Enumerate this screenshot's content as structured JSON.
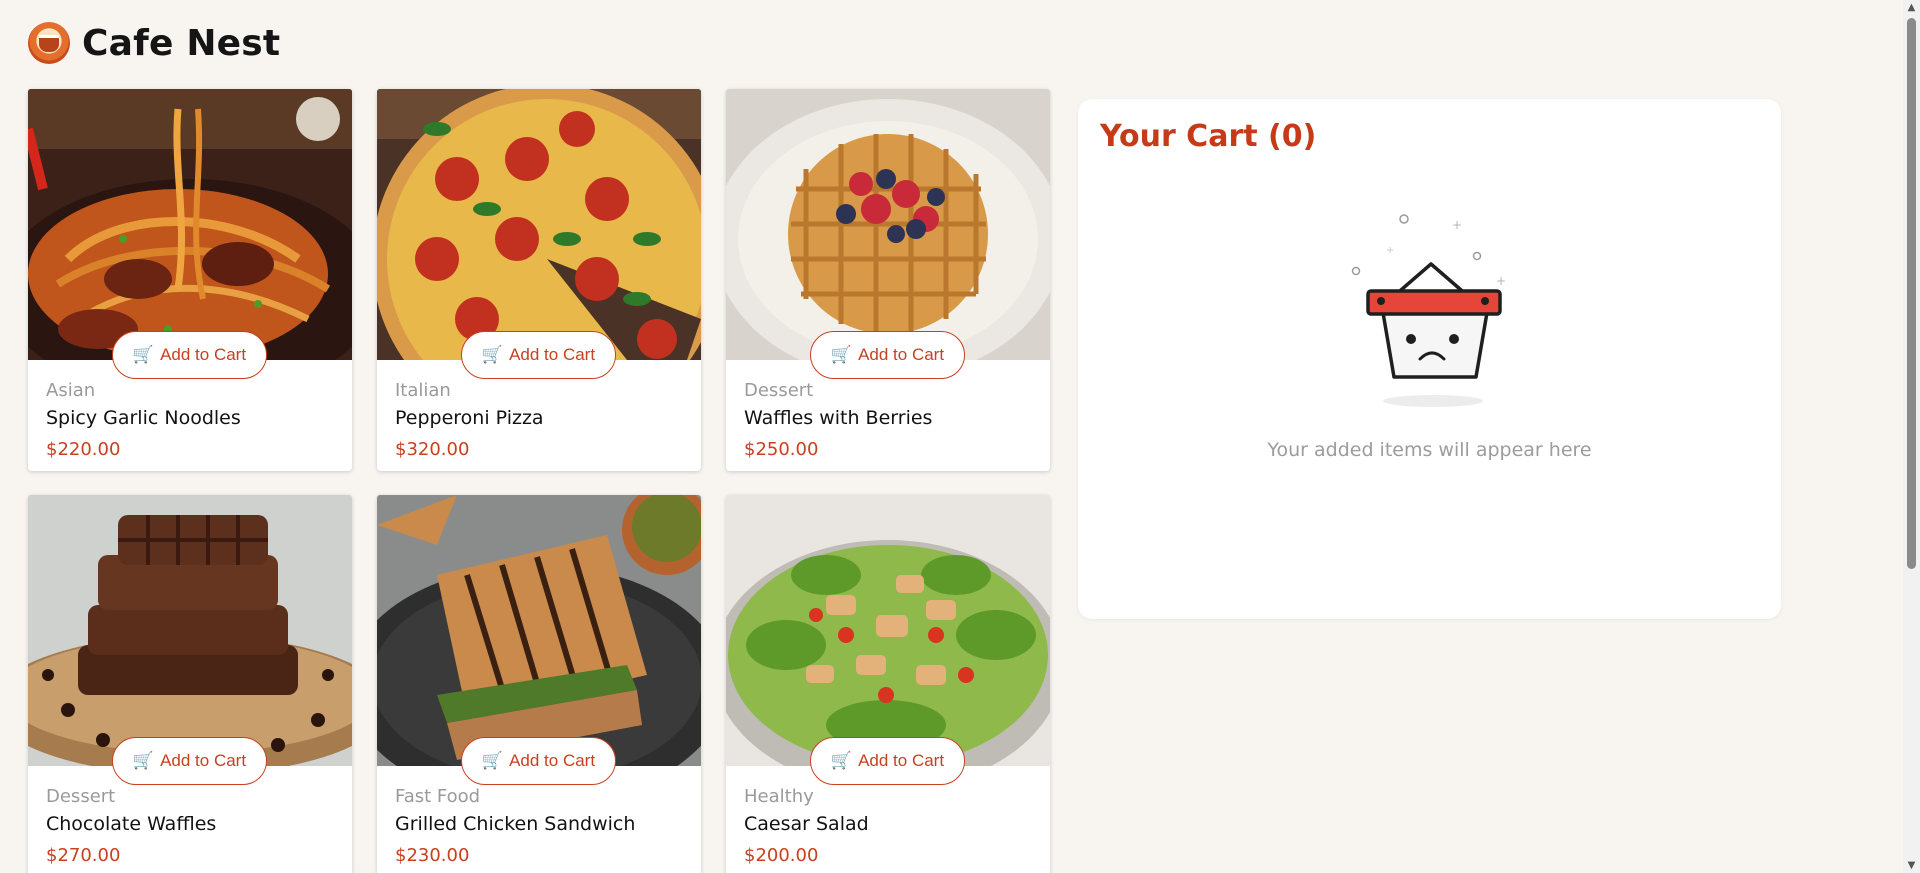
{
  "brand": {
    "name": "Cafe Nest",
    "logo_icon": "cafe-logo-icon"
  },
  "menu": {
    "items": [
      {
        "category": "Asian",
        "name": "Spicy Garlic Noodles",
        "price": "$220.00",
        "button": "Add to Cart",
        "image": "noodles"
      },
      {
        "category": "Italian",
        "name": "Pepperoni Pizza",
        "price": "$320.00",
        "button": "Add to Cart",
        "image": "pizza"
      },
      {
        "category": "Dessert",
        "name": "Waffles with Berries",
        "price": "$250.00",
        "button": "Add to Cart",
        "image": "waffle-berries"
      },
      {
        "category": "Dessert",
        "name": "Chocolate Waffles",
        "price": "$270.00",
        "button": "Add to Cart",
        "image": "choc-waffles"
      },
      {
        "category": "Fast Food",
        "name": "Grilled Chicken Sandwich",
        "price": "$230.00",
        "button": "Add to Cart",
        "image": "sandwich"
      },
      {
        "category": "Healthy",
        "name": "Caesar Salad",
        "price": "$200.00",
        "button": "Add to Cart",
        "image": "salad"
      }
    ]
  },
  "cart": {
    "title": "Your Cart (0)",
    "empty_message": "Your added items will appear here",
    "empty_icon": "sad-basket-icon"
  },
  "colors": {
    "accent": "#c9401f",
    "background": "#f8f5f1",
    "card": "#ffffff"
  }
}
